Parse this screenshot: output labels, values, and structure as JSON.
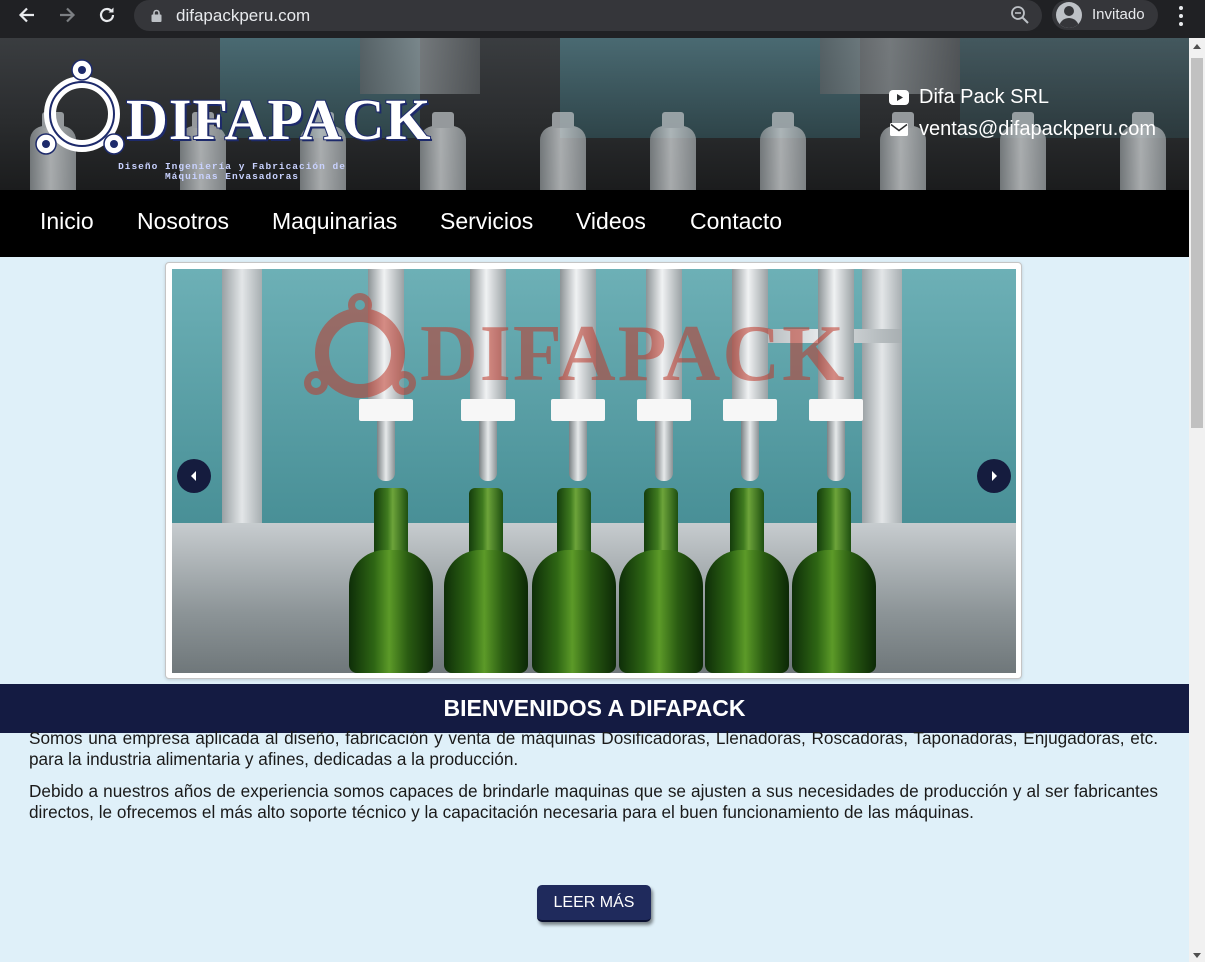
{
  "browser": {
    "url": "difapackperu.com",
    "profile_label": "Invitado"
  },
  "header": {
    "logo_text": "DIFAPACK",
    "logo_subtitle_line1": "Diseño Ingeniería y Fabricación de",
    "logo_subtitle_line2": "Máquinas Envasadoras",
    "youtube_label": "Difa Pack SRL",
    "email_label": "ventas@difapackperu.com"
  },
  "nav": {
    "items": [
      {
        "label": "Inicio"
      },
      {
        "label": "Nosotros"
      },
      {
        "label": "Maquinarias"
      },
      {
        "label": "Servicios"
      },
      {
        "label": "Videos"
      },
      {
        "label": "Contacto"
      }
    ]
  },
  "carousel": {
    "watermark_text": "DIFAPACK"
  },
  "welcome": {
    "title": "BIENVENIDOS A DIFAPACK",
    "paragraph1": "Somos una empresa aplicada al diseño, fabricación y venta de máquinas Dosificadoras, Llenadoras, Roscadoras, Taponadoras, Enjugadoras, etc. para la industria alimentaria y afines, dedicadas a la producción.",
    "paragraph2": "Debido a nuestros años de experiencia somos capaces de brindarle maquinas que se ajusten a sus necesidades de producción y al ser fabricantes directos, le ofrecemos el más alto soporte técnico y la capacitación necesaria para el buen funcionamiento de las máquinas.",
    "button_label": "LEER MÁS"
  },
  "colors": {
    "page_bg": "#dff0f9",
    "nav_bg": "#000000",
    "brand_navy": "#141b42",
    "button_bg": "#1f2a5c"
  },
  "icons": [
    "back-arrow-icon",
    "forward-arrow-icon",
    "reload-icon",
    "lock-icon",
    "zoom-icon",
    "profile-avatar-icon",
    "menu-dots-icon",
    "youtube-icon",
    "envelope-icon",
    "chevron-left-icon",
    "chevron-right-icon"
  ]
}
